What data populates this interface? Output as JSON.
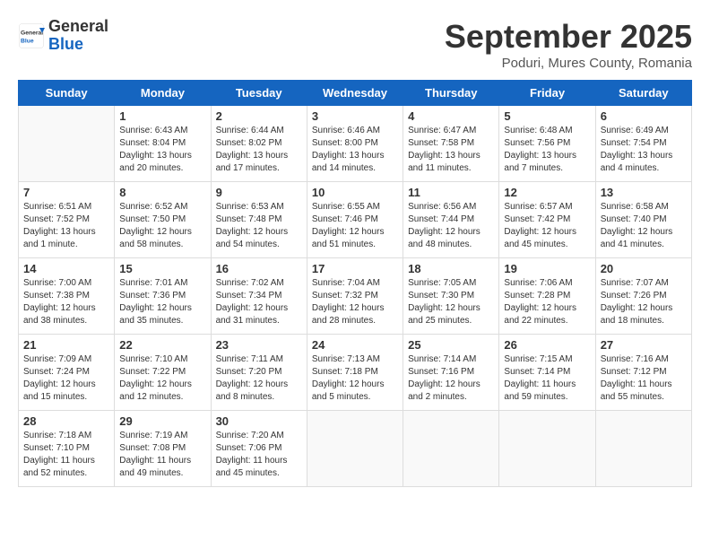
{
  "header": {
    "logo": {
      "general": "General",
      "blue": "Blue"
    },
    "title": "September 2025",
    "location": "Poduri, Mures County, Romania"
  },
  "days_of_week": [
    "Sunday",
    "Monday",
    "Tuesday",
    "Wednesday",
    "Thursday",
    "Friday",
    "Saturday"
  ],
  "weeks": [
    [
      {
        "day": "",
        "info": ""
      },
      {
        "day": "1",
        "info": "Sunrise: 6:43 AM\nSunset: 8:04 PM\nDaylight: 13 hours and 20 minutes."
      },
      {
        "day": "2",
        "info": "Sunrise: 6:44 AM\nSunset: 8:02 PM\nDaylight: 13 hours and 17 minutes."
      },
      {
        "day": "3",
        "info": "Sunrise: 6:46 AM\nSunset: 8:00 PM\nDaylight: 13 hours and 14 minutes."
      },
      {
        "day": "4",
        "info": "Sunrise: 6:47 AM\nSunset: 7:58 PM\nDaylight: 13 hours and 11 minutes."
      },
      {
        "day": "5",
        "info": "Sunrise: 6:48 AM\nSunset: 7:56 PM\nDaylight: 13 hours and 7 minutes."
      },
      {
        "day": "6",
        "info": "Sunrise: 6:49 AM\nSunset: 7:54 PM\nDaylight: 13 hours and 4 minutes."
      }
    ],
    [
      {
        "day": "7",
        "info": "Sunrise: 6:51 AM\nSunset: 7:52 PM\nDaylight: 13 hours and 1 minute."
      },
      {
        "day": "8",
        "info": "Sunrise: 6:52 AM\nSunset: 7:50 PM\nDaylight: 12 hours and 58 minutes."
      },
      {
        "day": "9",
        "info": "Sunrise: 6:53 AM\nSunset: 7:48 PM\nDaylight: 12 hours and 54 minutes."
      },
      {
        "day": "10",
        "info": "Sunrise: 6:55 AM\nSunset: 7:46 PM\nDaylight: 12 hours and 51 minutes."
      },
      {
        "day": "11",
        "info": "Sunrise: 6:56 AM\nSunset: 7:44 PM\nDaylight: 12 hours and 48 minutes."
      },
      {
        "day": "12",
        "info": "Sunrise: 6:57 AM\nSunset: 7:42 PM\nDaylight: 12 hours and 45 minutes."
      },
      {
        "day": "13",
        "info": "Sunrise: 6:58 AM\nSunset: 7:40 PM\nDaylight: 12 hours and 41 minutes."
      }
    ],
    [
      {
        "day": "14",
        "info": "Sunrise: 7:00 AM\nSunset: 7:38 PM\nDaylight: 12 hours and 38 minutes."
      },
      {
        "day": "15",
        "info": "Sunrise: 7:01 AM\nSunset: 7:36 PM\nDaylight: 12 hours and 35 minutes."
      },
      {
        "day": "16",
        "info": "Sunrise: 7:02 AM\nSunset: 7:34 PM\nDaylight: 12 hours and 31 minutes."
      },
      {
        "day": "17",
        "info": "Sunrise: 7:04 AM\nSunset: 7:32 PM\nDaylight: 12 hours and 28 minutes."
      },
      {
        "day": "18",
        "info": "Sunrise: 7:05 AM\nSunset: 7:30 PM\nDaylight: 12 hours and 25 minutes."
      },
      {
        "day": "19",
        "info": "Sunrise: 7:06 AM\nSunset: 7:28 PM\nDaylight: 12 hours and 22 minutes."
      },
      {
        "day": "20",
        "info": "Sunrise: 7:07 AM\nSunset: 7:26 PM\nDaylight: 12 hours and 18 minutes."
      }
    ],
    [
      {
        "day": "21",
        "info": "Sunrise: 7:09 AM\nSunset: 7:24 PM\nDaylight: 12 hours and 15 minutes."
      },
      {
        "day": "22",
        "info": "Sunrise: 7:10 AM\nSunset: 7:22 PM\nDaylight: 12 hours and 12 minutes."
      },
      {
        "day": "23",
        "info": "Sunrise: 7:11 AM\nSunset: 7:20 PM\nDaylight: 12 hours and 8 minutes."
      },
      {
        "day": "24",
        "info": "Sunrise: 7:13 AM\nSunset: 7:18 PM\nDaylight: 12 hours and 5 minutes."
      },
      {
        "day": "25",
        "info": "Sunrise: 7:14 AM\nSunset: 7:16 PM\nDaylight: 12 hours and 2 minutes."
      },
      {
        "day": "26",
        "info": "Sunrise: 7:15 AM\nSunset: 7:14 PM\nDaylight: 11 hours and 59 minutes."
      },
      {
        "day": "27",
        "info": "Sunrise: 7:16 AM\nSunset: 7:12 PM\nDaylight: 11 hours and 55 minutes."
      }
    ],
    [
      {
        "day": "28",
        "info": "Sunrise: 7:18 AM\nSunset: 7:10 PM\nDaylight: 11 hours and 52 minutes."
      },
      {
        "day": "29",
        "info": "Sunrise: 7:19 AM\nSunset: 7:08 PM\nDaylight: 11 hours and 49 minutes."
      },
      {
        "day": "30",
        "info": "Sunrise: 7:20 AM\nSunset: 7:06 PM\nDaylight: 11 hours and 45 minutes."
      },
      {
        "day": "",
        "info": ""
      },
      {
        "day": "",
        "info": ""
      },
      {
        "day": "",
        "info": ""
      },
      {
        "day": "",
        "info": ""
      }
    ]
  ]
}
